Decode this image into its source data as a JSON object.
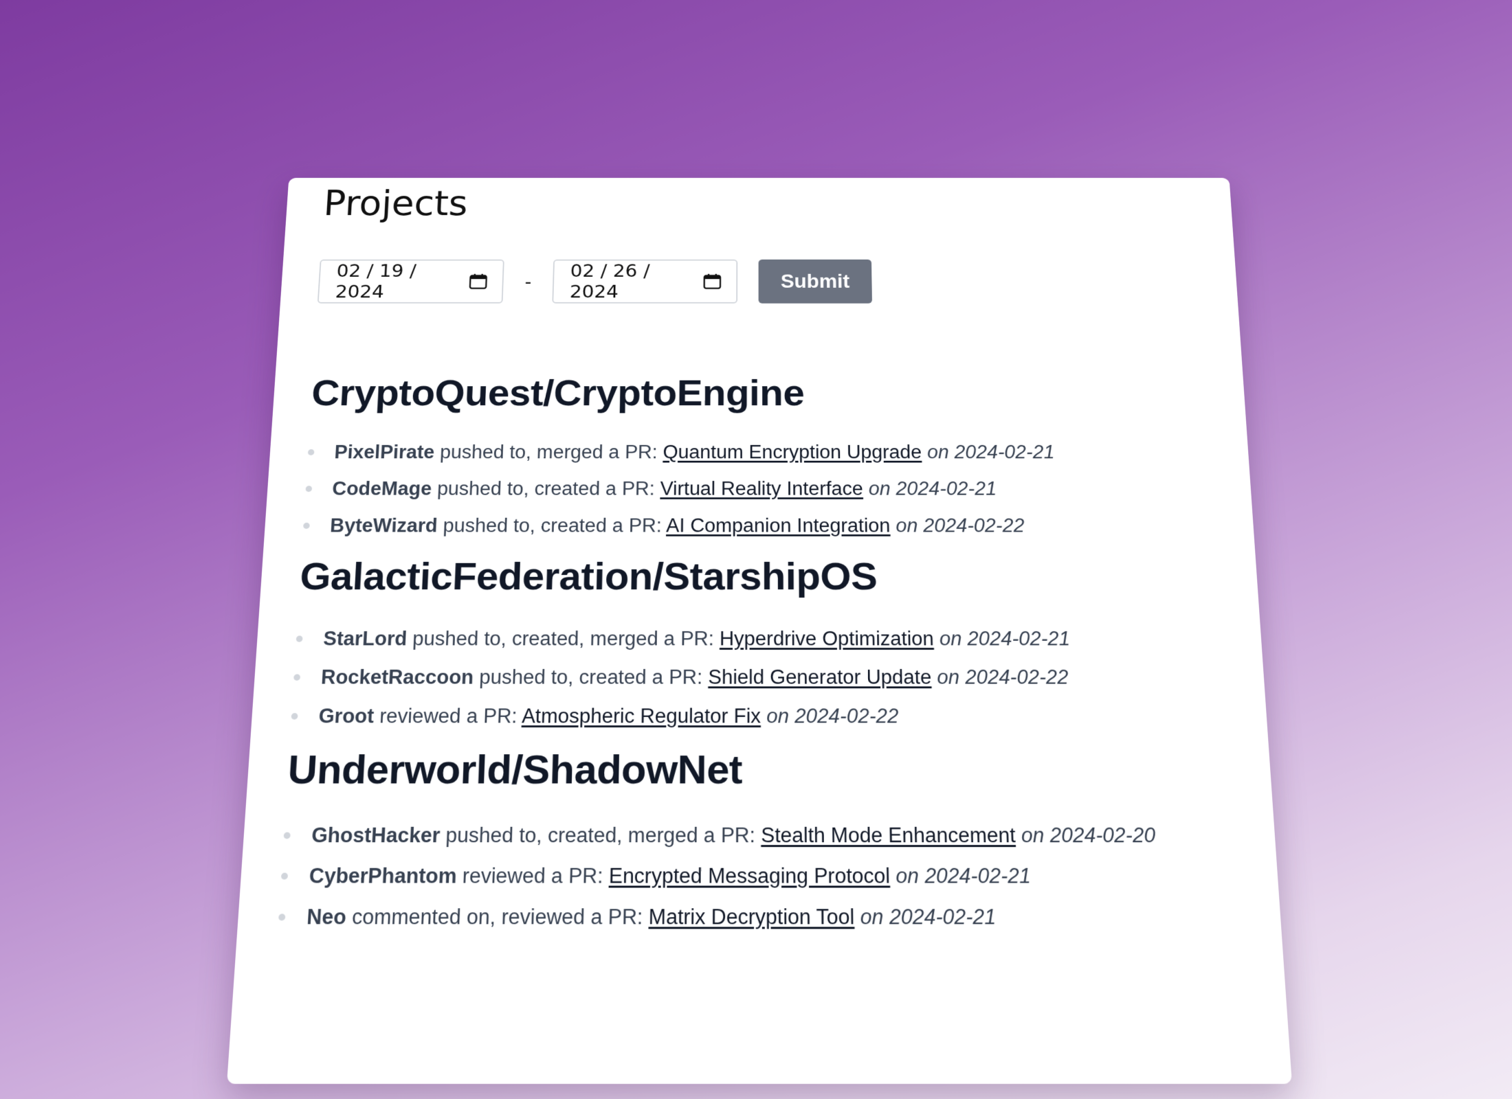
{
  "page": {
    "title": "Projects"
  },
  "filters": {
    "start_date": "02 / 19 / 2024",
    "separator": "-",
    "end_date": "02 / 26 / 2024",
    "submit_label": "Submit"
  },
  "projects": [
    {
      "name": "CryptoQuest/CryptoEngine",
      "activities": [
        {
          "user": "PixelPirate",
          "action": "pushed to, merged a PR:",
          "pr": "Quantum Encryption Upgrade",
          "on": "on",
          "date": "2024-02-21"
        },
        {
          "user": "CodeMage",
          "action": "pushed to, created a PR:",
          "pr": "Virtual Reality Interface",
          "on": "on",
          "date": "2024-02-21"
        },
        {
          "user": "ByteWizard",
          "action": "pushed to, created a PR:",
          "pr": "AI Companion Integration",
          "on": "on",
          "date": "2024-02-22"
        }
      ]
    },
    {
      "name": "GalacticFederation/StarshipOS",
      "activities": [
        {
          "user": "StarLord",
          "action": "pushed to, created, merged a PR:",
          "pr": "Hyperdrive Optimization",
          "on": "on",
          "date": "2024-02-21"
        },
        {
          "user": "RocketRaccoon",
          "action": "pushed to, created a PR:",
          "pr": "Shield Generator Update",
          "on": "on",
          "date": "2024-02-22"
        },
        {
          "user": "Groot",
          "action": "reviewed a PR:",
          "pr": "Atmospheric Regulator Fix",
          "on": "on",
          "date": "2024-02-22"
        }
      ]
    },
    {
      "name": "Underworld/ShadowNet",
      "activities": [
        {
          "user": "GhostHacker",
          "action": "pushed to, created, merged a PR:",
          "pr": "Stealth Mode Enhancement",
          "on": "on",
          "date": "2024-02-20"
        },
        {
          "user": "CyberPhantom",
          "action": "reviewed a PR:",
          "pr": "Encrypted Messaging Protocol",
          "on": "on",
          "date": "2024-02-21"
        },
        {
          "user": "Neo",
          "action": "commented on, reviewed a PR:",
          "pr": "Matrix Decryption Tool",
          "on": "on",
          "date": "2024-02-21"
        }
      ]
    }
  ]
}
